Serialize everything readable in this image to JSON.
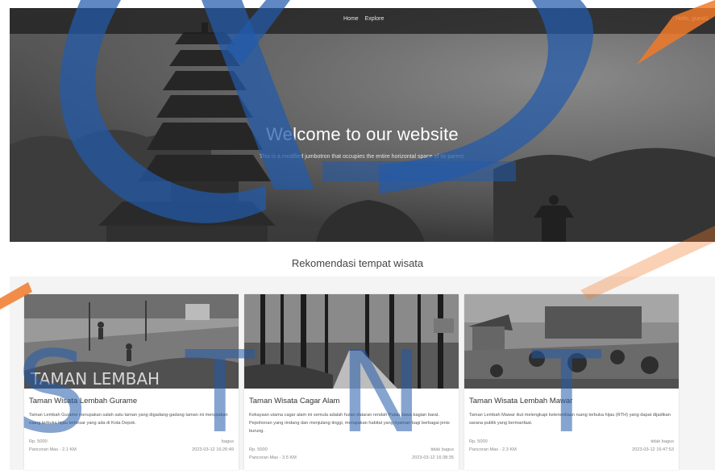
{
  "nav": {
    "links": [
      "Home",
      "Explore"
    ],
    "greeting": "Hello, guest1"
  },
  "hero": {
    "title": "Welcome to our website",
    "subtitle": "This is a modified jumbotron that occupies the entire horizontal space of its parent."
  },
  "section": {
    "title": "Rekomendasi tempat wisata"
  },
  "cards": [
    {
      "title": "Taman Wisata Lembah Gurame",
      "description": "Taman Lembah Gurame merupakan salah satu taman yang digadang-gadang taman ini merupakan ruang terbuka hijau terbesar yang ada di Kota Depok.",
      "price": "Rp. 5000",
      "rating": "bagus",
      "location": "Pancoran Mas - 2.1 KM",
      "date": "2023-03-12 16:26:49",
      "photo_sign_text": "TAMAN LEMBAH"
    },
    {
      "title": "Taman Wisata Cagar Alam",
      "description": "Kekayaan utama cagar alam ini semula adalah hutan dataran rendah Pulau Jawa bagian barat. Pepohonan yang rindang dan menjulang tinggi, merupakan habitat yang nyaman bagi berbagai jenis burung.",
      "price": "Rp. 5000",
      "rating": "tidak bagus",
      "location": "Pancoran Mas - 3.5 KM",
      "date": "2023-03-12 16:38:35"
    },
    {
      "title": "Taman Wisata Lembah Mawar",
      "description": "Taman Lembah Mawar ikut melengkapi ketersediaan ruang terbuka hijau (RTH) yang dapat dijadikan sarana publik yang bermanfaat.",
      "price": "Rp. 5000",
      "rating": "tidak bagus",
      "location": "Pancoran Mas - 2.3 KM",
      "date": "2023-03-12 16:47:53"
    }
  ],
  "watermark": {
    "letters": [
      "S",
      "T",
      "N",
      "T"
    ]
  },
  "colors": {
    "watermark_blue": "#225aaa",
    "watermark_orange": "#f07a2a",
    "navbar": "#1e1e1e",
    "section_bg": "#f4f4f4"
  }
}
